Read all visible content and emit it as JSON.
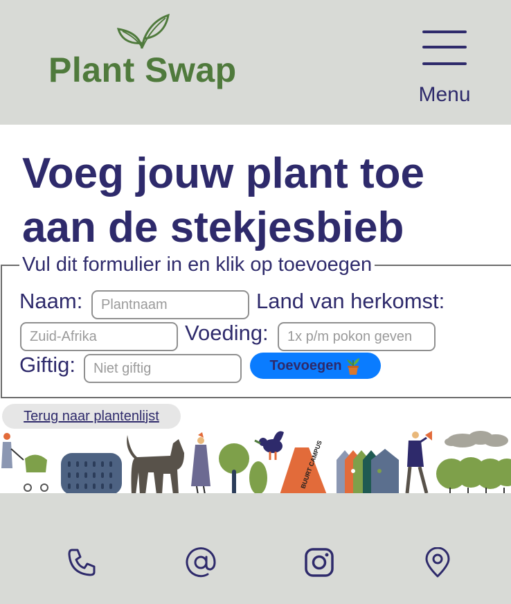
{
  "header": {
    "logo_text": "Plant Swap",
    "menu_label": "Menu"
  },
  "main": {
    "title": "Voeg jouw plant toe aan de stekjesbieb"
  },
  "form": {
    "legend": "Vul dit formulier in en klik op toevoegen",
    "fields": {
      "naam": {
        "label": "Naam:",
        "placeholder": "Plantnaam",
        "value": ""
      },
      "land": {
        "label": "Land van herkomst:",
        "placeholder": "Zuid-Afrika",
        "value": ""
      },
      "voeding": {
        "label": "Voeding:",
        "placeholder": "1x p/m pokon geven",
        "value": ""
      },
      "giftig": {
        "label": "Giftig:",
        "placeholder": "Niet giftig",
        "value": ""
      }
    },
    "submit_label": "Toevoegen"
  },
  "back_link": {
    "label": "Terug naar plantenlijst"
  },
  "illustration": {
    "sign_text": "BUURT CAMPUS"
  },
  "footer": {
    "icons": [
      "phone-icon",
      "at-sign-icon",
      "instagram-icon",
      "location-pin-icon"
    ]
  },
  "colors": {
    "header_bg": "#d8dad6",
    "brand_green": "#4f7a3c",
    "primary_text": "#2e2a6b",
    "button_blue": "#0a7cff",
    "footer_bg": "#d8dad6"
  }
}
